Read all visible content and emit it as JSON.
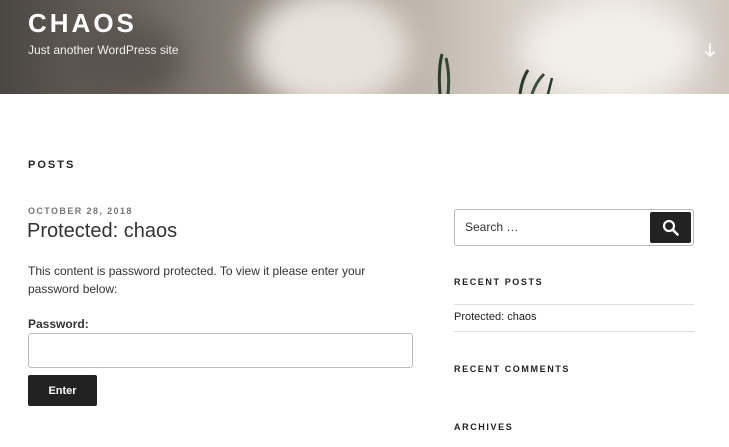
{
  "header": {
    "site_title": "CHAOS",
    "tagline": "Just another WordPress site"
  },
  "main": {
    "section_heading": "POSTS",
    "post": {
      "date": "OCTOBER 28, 2018",
      "title": "Protected: chaos",
      "message": "This content is password protected. To view it please enter your password below:",
      "password_label": "Password:",
      "password_value": "",
      "submit_label": "Enter"
    }
  },
  "sidebar": {
    "search": {
      "placeholder": "Search …",
      "icon": "search-icon"
    },
    "recent_posts": {
      "title": "RECENT POSTS",
      "items": [
        "Protected: chaos"
      ]
    },
    "recent_comments": {
      "title": "RECENT COMMENTS"
    },
    "archives": {
      "title": "ARCHIVES"
    }
  },
  "colors": {
    "button_bg": "#222222",
    "text": "#222222",
    "meta": "#767676"
  }
}
